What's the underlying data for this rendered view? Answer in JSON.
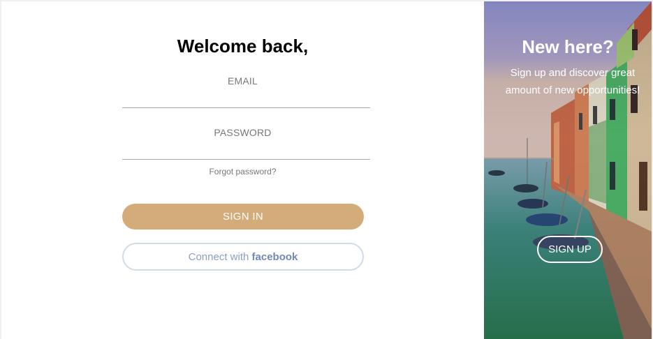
{
  "login": {
    "title": "Welcome back,",
    "email_label": "EMAIL",
    "email_value": "",
    "password_label": "PASSWORD",
    "password_value": "",
    "forgot_link": "Forgot password?",
    "signin_button": "SIGN IN",
    "facebook_prefix": "Connect with",
    "facebook_brand": "facebook"
  },
  "promo": {
    "title": "New here?",
    "text": "Sign up and discover great amount of new opportunities!",
    "signup_button": "SIGN UP"
  },
  "colors": {
    "accent": "#d4ac7a",
    "facebook_border": "#d0dbe8",
    "facebook_text": "#8aa0c4"
  },
  "icons": {
    "background_image": "canal-village-photo"
  }
}
